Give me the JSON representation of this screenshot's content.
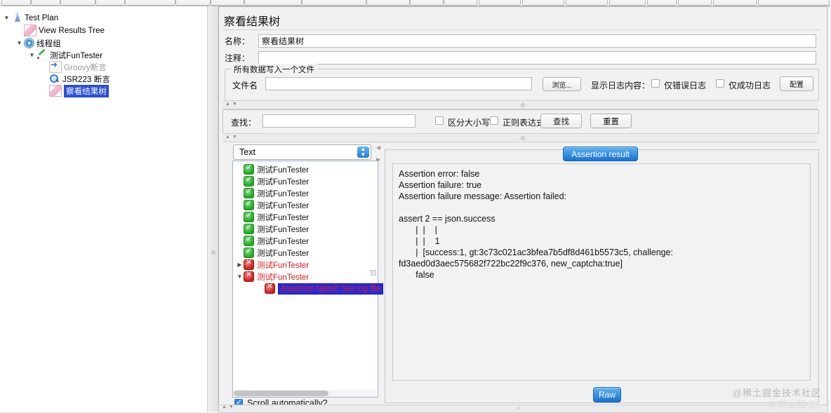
{
  "window": {
    "watermark": "@稀土掘金技术社区",
    "watermark_faint": "@稀土掘金"
  },
  "tree": {
    "items": [
      {
        "label": "Test Plan",
        "icon": "flask-icon",
        "indent": 0,
        "twisty": "▼",
        "state": "normal"
      },
      {
        "label": "View Results Tree",
        "icon": "chart-icon",
        "indent": 1,
        "twisty": "",
        "state": "normal"
      },
      {
        "label": "线程组",
        "icon": "gear-icon",
        "indent": 1,
        "twisty": "▼",
        "state": "normal"
      },
      {
        "label": "测试FunTester",
        "icon": "pencil-icon",
        "indent": 2,
        "twisty": "▼",
        "state": "normal"
      },
      {
        "label": "Groovy断言",
        "icon": "arrow-icon",
        "indent": 3,
        "twisty": "",
        "state": "disabled"
      },
      {
        "label": "JSR223 断言",
        "icon": "magnifier-icon",
        "indent": 3,
        "twisty": "",
        "state": "normal"
      },
      {
        "label": "察看结果树",
        "icon": "chart-icon",
        "indent": 3,
        "twisty": "",
        "state": "selected"
      }
    ]
  },
  "main": {
    "title": "察看结果树",
    "name_label": "名称：",
    "name_value": "察看结果树",
    "comment_label": "注释：",
    "comment_value": "",
    "group": {
      "legend": "所有数据写入一个文件",
      "filename_label": "文件名",
      "filename_value": "",
      "browse_button": "浏览...",
      "log_content_label": "显示日志内容：",
      "errors_only_label": "仅错误日志",
      "errors_only_checked": false,
      "success_only_label": "仅成功日志",
      "success_only_checked": false,
      "configure_button": "配置"
    },
    "search": {
      "label": "查找：",
      "value": "",
      "case_label": "区分大小写",
      "case_checked": false,
      "regex_label": "正则表达式",
      "regex_checked": false,
      "find_button": "查找",
      "reset_button": "重置"
    },
    "render_selector": "Text",
    "results": [
      {
        "label": "测试FunTester",
        "status": "ok",
        "twisty": "",
        "indent": 0,
        "selected": false
      },
      {
        "label": "测试FunTester",
        "status": "ok",
        "twisty": "",
        "indent": 0,
        "selected": false
      },
      {
        "label": "测试FunTester",
        "status": "ok",
        "twisty": "",
        "indent": 0,
        "selected": false
      },
      {
        "label": "测试FunTester",
        "status": "ok",
        "twisty": "",
        "indent": 0,
        "selected": false
      },
      {
        "label": "测试FunTester",
        "status": "ok",
        "twisty": "",
        "indent": 0,
        "selected": false
      },
      {
        "label": "测试FunTester",
        "status": "ok",
        "twisty": "",
        "indent": 0,
        "selected": false
      },
      {
        "label": "测试FunTester",
        "status": "ok",
        "twisty": "",
        "indent": 0,
        "selected": false
      },
      {
        "label": "测试FunTester",
        "status": "ok",
        "twisty": "",
        "indent": 0,
        "selected": false
      },
      {
        "label": "测试FunTester",
        "status": "fail",
        "twisty": "▶",
        "indent": 0,
        "selected": false
      },
      {
        "label": "测试FunTester",
        "status": "fail",
        "twisty": "▼",
        "indent": 0,
        "selected": false
      },
      {
        "label": "Assertion failed! See log file",
        "status": "fail",
        "twisty": "",
        "indent": 1,
        "selected": true
      }
    ],
    "scroll_auto_label": "Scroll automatically?",
    "scroll_auto_checked": true,
    "assertion_tab": "Assertion result",
    "assertion_text": "Assertion error: false\nAssertion failure: true\nAssertion failure message: Assertion failed:\n\nassert 2 == json.success\n       |  |    |\n       |  |    1\n       |  [success:1, gt:3c73c021ac3bfea7b5df8d461b5573c5, challenge:\nfd3aed0d3aec575682f722bc22f9c376, new_captcha:true]\n       false",
    "raw_button": "Raw"
  },
  "colors": {
    "accent_blue": "#1773d4",
    "fail_red": "#e01b1b",
    "ok_green": "#24a324",
    "selection_blue": "#2a4fd7"
  }
}
